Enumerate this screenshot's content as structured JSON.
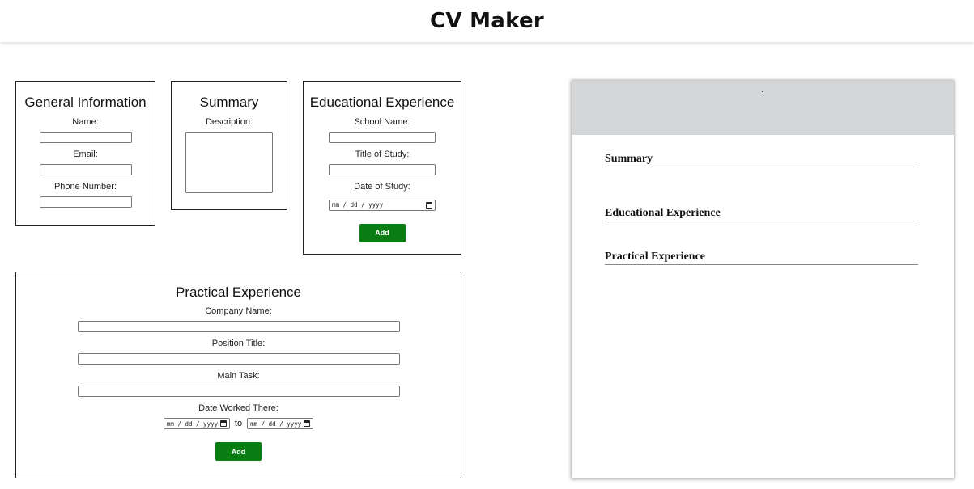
{
  "app": {
    "title": "CV Maker"
  },
  "general": {
    "heading": "General Information",
    "name_label": "Name:",
    "name_value": "",
    "email_label": "Email:",
    "email_value": "",
    "phone_label": "Phone Number:",
    "phone_value": ""
  },
  "summary": {
    "heading": "Summary",
    "description_label": "Description:",
    "description_value": ""
  },
  "education": {
    "heading": "Educational Experience",
    "school_label": "School Name:",
    "school_value": "",
    "title_label": "Title of Study:",
    "title_value": "",
    "date_label": "Date of Study:",
    "date_placeholder": "mm / dd / yyyy",
    "add_label": "Add"
  },
  "practical": {
    "heading": "Practical Experience",
    "company_label": "Company Name:",
    "company_value": "",
    "position_label": "Position Title:",
    "position_value": "",
    "task_label": "Main Task:",
    "task_value": "",
    "date_label": "Date Worked There:",
    "from_placeholder": "mm / dd / yyyy",
    "to_label": "to",
    "to_placeholder": "mm / dd / yyyy",
    "add_label": "Add"
  },
  "preview": {
    "header_text": ".",
    "summary_heading": "Summary",
    "education_heading": "Educational Experience",
    "practical_heading": "Practical Experience"
  },
  "colors": {
    "accent_button": "#0a7d12",
    "preview_header_bg": "#d5d6d7"
  },
  "icons": [
    "calendar-icon"
  ]
}
